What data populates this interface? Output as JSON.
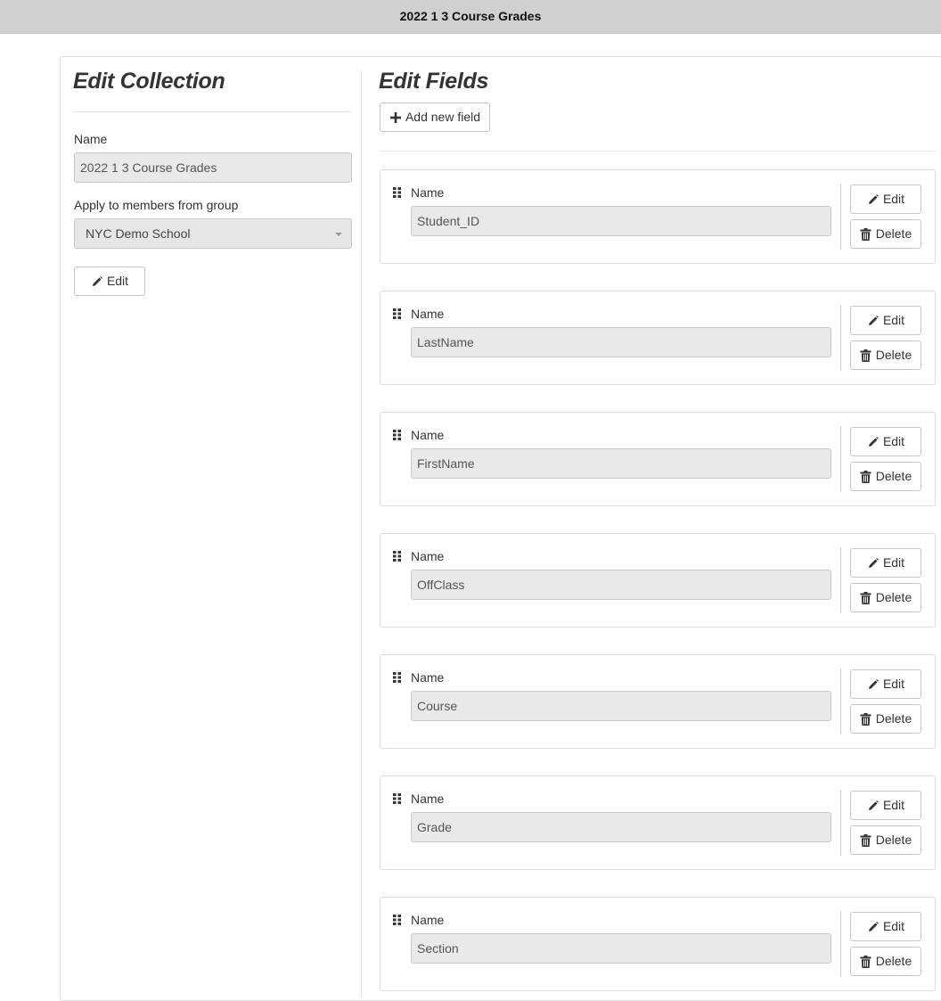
{
  "window": {
    "title": "2022 1 3 Course Grades"
  },
  "collection": {
    "heading": "Edit Collection",
    "name_label": "Name",
    "name_value": "2022 1 3 Course Grades",
    "group_label": "Apply to members from group",
    "group_value": "NYC Demo School",
    "edit_label": "Edit"
  },
  "fields": {
    "heading": "Edit Fields",
    "add_label": "Add new field",
    "items": [
      {
        "label": "Name",
        "value": "Student_ID",
        "edit_label": "Edit",
        "delete_label": "Delete"
      },
      {
        "label": "Name",
        "value": "LastName",
        "edit_label": "Edit",
        "delete_label": "Delete"
      },
      {
        "label": "Name",
        "value": "FirstName",
        "edit_label": "Edit",
        "delete_label": "Delete"
      },
      {
        "label": "Name",
        "value": "OffClass",
        "edit_label": "Edit",
        "delete_label": "Delete"
      },
      {
        "label": "Name",
        "value": "Course",
        "edit_label": "Edit",
        "delete_label": "Delete"
      },
      {
        "label": "Name",
        "value": "Grade",
        "edit_label": "Edit",
        "delete_label": "Delete"
      },
      {
        "label": "Name",
        "value": "Section",
        "edit_label": "Edit",
        "delete_label": "Delete"
      }
    ]
  },
  "icons": {
    "edit": "pencil-icon",
    "delete": "trash-icon",
    "add": "plus-icon",
    "drag": "drag-handle-icon",
    "dropdown": "chevron-down-icon"
  }
}
